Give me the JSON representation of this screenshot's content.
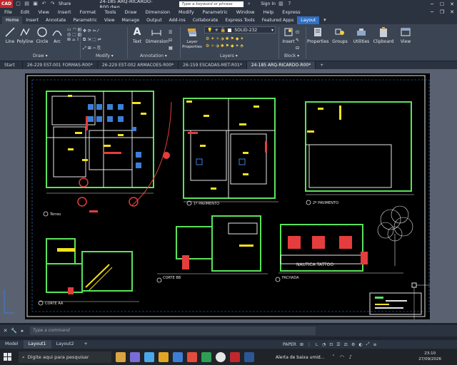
{
  "titlebar": {
    "app_badge": "CAD",
    "share_label": "Share",
    "file_title": "24-185 ARQ-RICARDO-R00.dwg",
    "search_placeholder": "Type a keyword or phrase",
    "signin_label": "Sign In"
  },
  "menubar": [
    "File",
    "Edit",
    "View",
    "Insert",
    "Format",
    "Tools",
    "Draw",
    "Dimension",
    "Modify",
    "Parametric",
    "Window",
    "Help",
    "Express"
  ],
  "ribbon_tabs": [
    {
      "label": "Home",
      "state": "active"
    },
    {
      "label": "Insert",
      "state": ""
    },
    {
      "label": "Annotate",
      "state": ""
    },
    {
      "label": "Parametric",
      "state": ""
    },
    {
      "label": "View",
      "state": ""
    },
    {
      "label": "Manage",
      "state": ""
    },
    {
      "label": "Output",
      "state": ""
    },
    {
      "label": "Add-ins",
      "state": ""
    },
    {
      "label": "Collaborate",
      "state": ""
    },
    {
      "label": "Express Tools",
      "state": ""
    },
    {
      "label": "Featured Apps",
      "state": ""
    },
    {
      "label": "Layout",
      "state": "layout"
    }
  ],
  "ribbon": {
    "draw_tools": [
      "Line",
      "Polyline",
      "Circle",
      "Arc"
    ],
    "text_tool": "Text",
    "dimension_tool": "Dimension",
    "layer_props": "Layer Properties",
    "layer_name": "SOLID-232",
    "insert_tool": "Insert",
    "right_tools": [
      "Properties",
      "Groups",
      "Utilities",
      "Clipboard",
      "View"
    ],
    "groups": {
      "draw": "Draw ▾",
      "modify": "Modify ▾",
      "annotation": "Annotation ▾",
      "layers": "Layers ▾",
      "block": "Block ▾"
    }
  },
  "file_tabs": [
    {
      "label": "Start",
      "active": false
    },
    {
      "label": "26-229 EST-001 FORMAS-R00*",
      "active": false
    },
    {
      "label": "26-229 EST-002 ARMACOES-R00*",
      "active": false
    },
    {
      "label": "26-159 ESCADAS-MET-R01*",
      "active": false
    },
    {
      "label": "24-185 ARQ-RICARDO-R00*",
      "active": true
    }
  ],
  "drawing": {
    "labels": {
      "plan1": "Térreo",
      "plan2": "1º PAVIMENTO",
      "plan3": "2º PAVIMENTO",
      "section_bb": "CORTE BB",
      "section_aa": "CORTE AA",
      "facade": "FACHADA",
      "facade_sign": "NAUTICA TATTOO"
    }
  },
  "cmdline": {
    "placeholder": "Type a command"
  },
  "layout_tabs": [
    {
      "label": "Model",
      "active": false
    },
    {
      "label": "Layout1",
      "active": true
    },
    {
      "label": "Layout2",
      "active": false
    },
    {
      "label": "+",
      "active": false
    }
  ],
  "statusbar": {
    "space": "PAPER"
  },
  "taskbar": {
    "search_placeholder": "Digite aqui para pesquisar",
    "notification": "Alerta de baixa umid...",
    "time": "23:10",
    "date": "27/09/2026"
  },
  "colors": {
    "accent": "#2f6fc4",
    "app_red": "#c1272d"
  }
}
